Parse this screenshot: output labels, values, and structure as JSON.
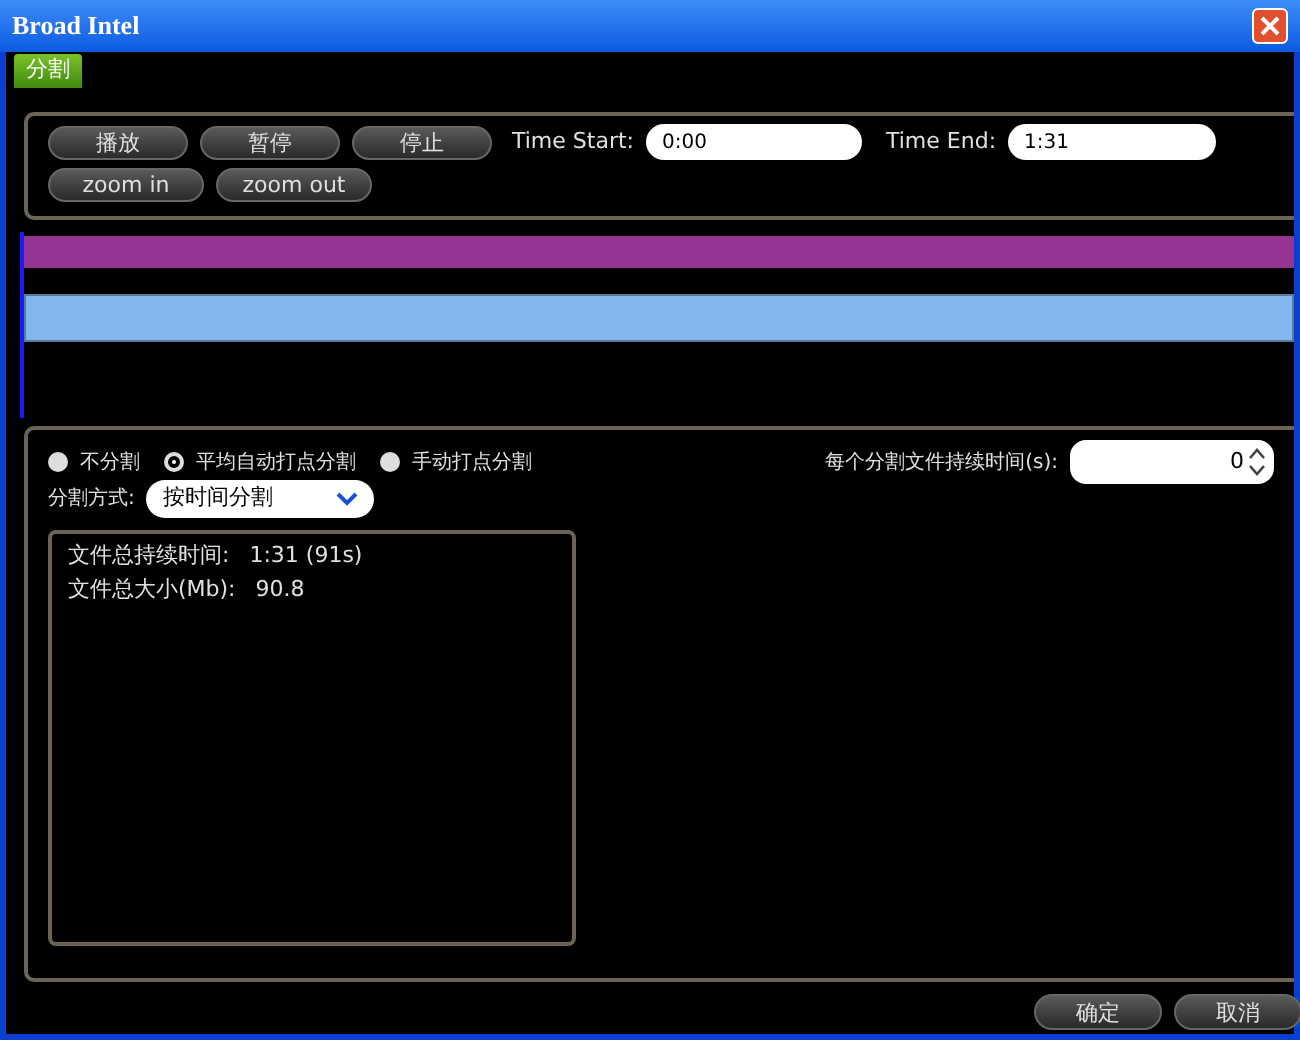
{
  "window": {
    "title": "Broad Intel"
  },
  "tabs": [
    {
      "label": "分割",
      "selected": true
    }
  ],
  "controls": {
    "buttons": [
      "播放",
      "暂停",
      "停止"
    ],
    "zoom_buttons": [
      "zoom in",
      "zoom out"
    ],
    "time_start": {
      "label": "Time Start:",
      "value": "0:00"
    },
    "time_end": {
      "label": "Time End:",
      "value": "1:31"
    }
  },
  "split_modes": [
    {
      "label": "不分割",
      "selected": false
    },
    {
      "label": "平均自动打点分割",
      "selected": true
    },
    {
      "label": "手动打点分割",
      "selected": false
    }
  ],
  "split_method": {
    "label": "分割方式:",
    "value": "按时间分割"
  },
  "duration_per_file": {
    "label": "每个分割文件持续时间(s):",
    "value": "0"
  },
  "info": [
    {
      "label": "文件总持续时间:",
      "value": "1:31 (91s)"
    },
    {
      "label": "文件总大小(Mb):",
      "value": "90.8"
    }
  ],
  "footer_buttons": [
    "确定",
    "取消"
  ]
}
